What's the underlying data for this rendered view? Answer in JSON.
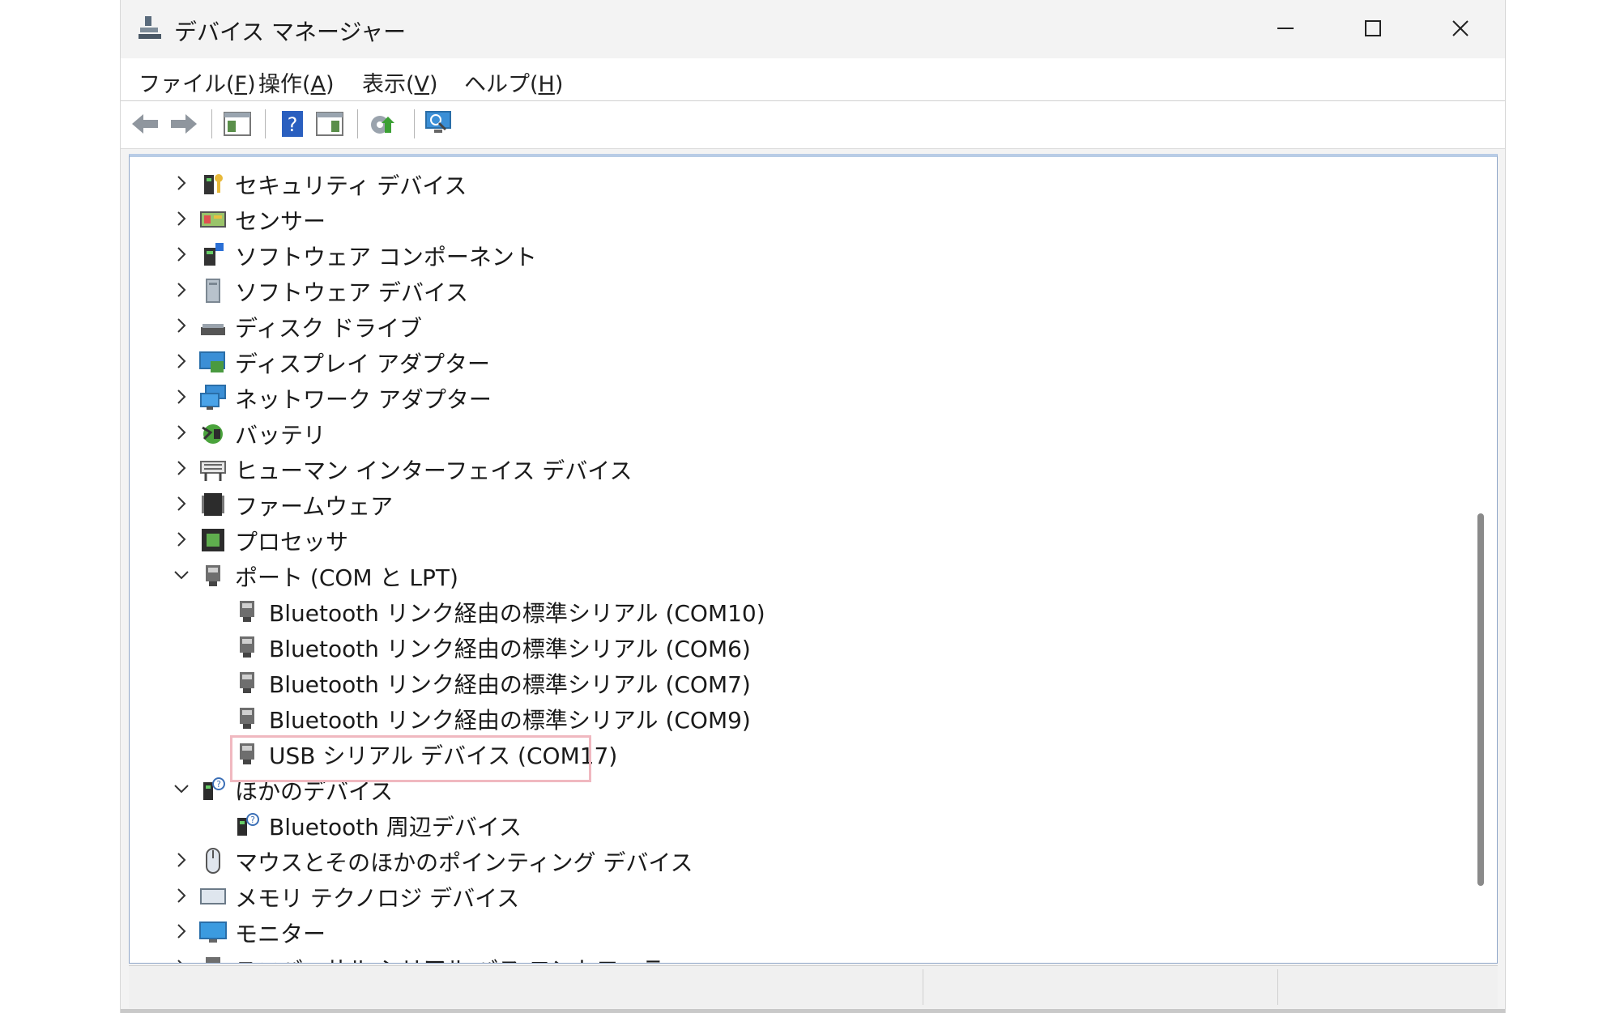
{
  "window": {
    "title": "デバイス マネージャー"
  },
  "menu": [
    {
      "label": "ファイル(",
      "key": "F",
      "close": ")"
    },
    {
      "label": "操作(",
      "key": "A",
      "close": ")"
    },
    {
      "label": "表示(",
      "key": "V",
      "close": ")"
    },
    {
      "label": "ヘルプ(",
      "key": "H",
      "close": ")"
    }
  ],
  "toolbar": [
    "back-icon",
    "forward-icon",
    "properties-pane-icon",
    "help-icon",
    "action-pane-icon",
    "update-driver-icon",
    "scan-hardware-icon"
  ],
  "tree": [
    {
      "label": "セキュリティ デバイス",
      "expanded": false,
      "level": 0,
      "icon": "security-device-icon"
    },
    {
      "label": "センサー",
      "expanded": false,
      "level": 0,
      "icon": "sensor-icon"
    },
    {
      "label": "ソフトウェア コンポーネント",
      "expanded": false,
      "level": 0,
      "icon": "software-component-icon"
    },
    {
      "label": "ソフトウェア デバイス",
      "expanded": false,
      "level": 0,
      "icon": "software-device-icon"
    },
    {
      "label": "ディスク ドライブ",
      "expanded": false,
      "level": 0,
      "icon": "disk-drive-icon"
    },
    {
      "label": "ディスプレイ アダプター",
      "expanded": false,
      "level": 0,
      "icon": "display-adapter-icon"
    },
    {
      "label": "ネットワーク アダプター",
      "expanded": false,
      "level": 0,
      "icon": "network-adapter-icon"
    },
    {
      "label": "バッテリ",
      "expanded": false,
      "level": 0,
      "icon": "battery-icon"
    },
    {
      "label": "ヒューマン インターフェイス デバイス",
      "expanded": false,
      "level": 0,
      "icon": "hid-icon"
    },
    {
      "label": "ファームウェア",
      "expanded": false,
      "level": 0,
      "icon": "firmware-icon"
    },
    {
      "label": "プロセッサ",
      "expanded": false,
      "level": 0,
      "icon": "processor-icon"
    },
    {
      "label": "ポート (COM と LPT)",
      "expanded": true,
      "level": 0,
      "icon": "port-icon"
    },
    {
      "label": "Bluetooth リンク経由の標準シリアル (COM10)",
      "level": 1,
      "icon": "port-icon"
    },
    {
      "label": "Bluetooth リンク経由の標準シリアル (COM6)",
      "level": 1,
      "icon": "port-icon"
    },
    {
      "label": "Bluetooth リンク経由の標準シリアル (COM7)",
      "level": 1,
      "icon": "port-icon"
    },
    {
      "label": "Bluetooth リンク経由の標準シリアル (COM9)",
      "level": 1,
      "icon": "port-icon"
    },
    {
      "label": "USB シリアル デバイス (COM17)",
      "level": 1,
      "icon": "port-icon",
      "highlighted": true
    },
    {
      "label": "ほかのデバイス",
      "expanded": true,
      "level": 0,
      "icon": "other-device-icon"
    },
    {
      "label": "Bluetooth 周辺デバイス",
      "level": 1,
      "icon": "unknown-device-icon"
    },
    {
      "label": "マウスとそのほかのポインティング デバイス",
      "expanded": false,
      "level": 0,
      "icon": "mouse-icon"
    },
    {
      "label": "メモリ テクノロジ デバイス",
      "expanded": false,
      "level": 0,
      "icon": "memory-icon"
    },
    {
      "label": "モニター",
      "expanded": false,
      "level": 0,
      "icon": "monitor-icon"
    },
    {
      "label": "ユニバーサル シリアル バス コントローラー",
      "expanded": false,
      "level": 0,
      "icon": "usb-controller-icon"
    }
  ],
  "colors": {
    "highlight": "#f0b8c0",
    "accent": "#1e78d7"
  }
}
